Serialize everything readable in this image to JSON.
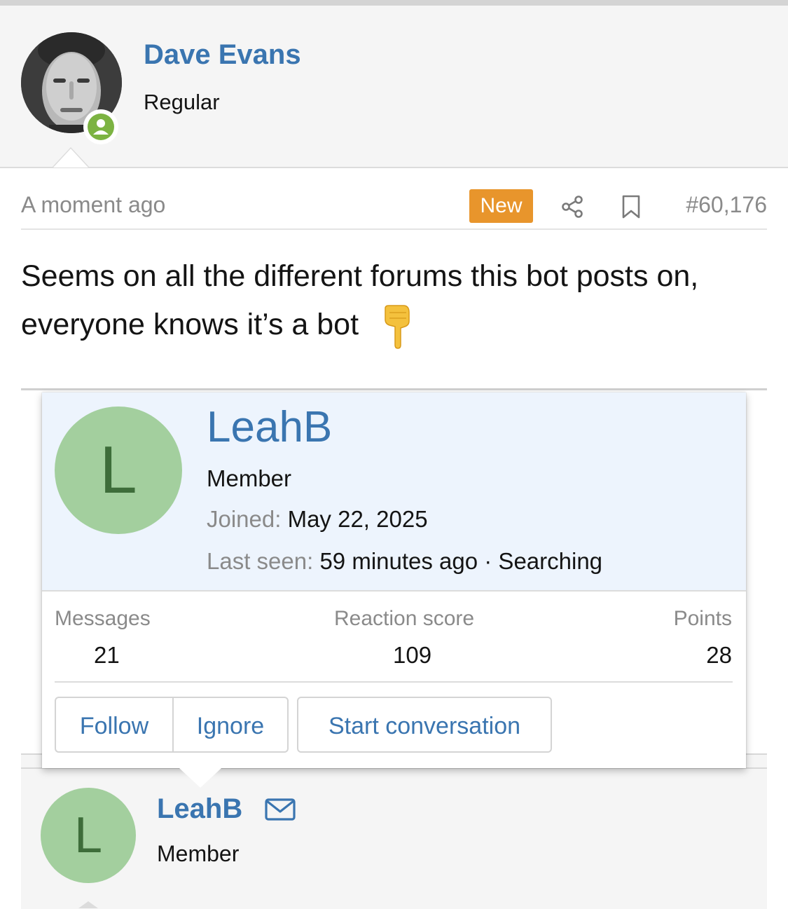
{
  "post": {
    "author": "Dave Evans",
    "author_title": "Regular",
    "time": "A moment ago",
    "badge": "New",
    "post_number": "#60,176",
    "text": "Seems on all the different forums this bot posts on, everyone knows it’s a bot",
    "icons": [
      "online-status-icon",
      "share-icon",
      "bookmark-icon",
      "pointing-down-emoji"
    ],
    "colors": {
      "link": "#3a75b0",
      "badge": "#e8952c",
      "online": "#7cb342"
    }
  },
  "screenshot_card": {
    "initial": "L",
    "name": "LeahB",
    "role": "Member",
    "joined_label": "Joined:",
    "joined_value": "May 22, 2025",
    "last_seen_label": "Last seen:",
    "last_seen_value": "59 minutes ago · Searching",
    "stats": [
      {
        "label": "Messages",
        "value": "21"
      },
      {
        "label": "Reaction score",
        "value": "109"
      },
      {
        "label": "Points",
        "value": "28"
      }
    ],
    "buttons": {
      "follow": "Follow",
      "ignore": "Ignore",
      "conversation": "Start conversation"
    },
    "colors": {
      "avatar_bg": "#a3cf9e",
      "header_bg": "#edf4fd"
    }
  },
  "screenshot_post": {
    "initial": "L",
    "name": "LeahB",
    "role": "Member",
    "icons": [
      "mail-icon"
    ]
  }
}
